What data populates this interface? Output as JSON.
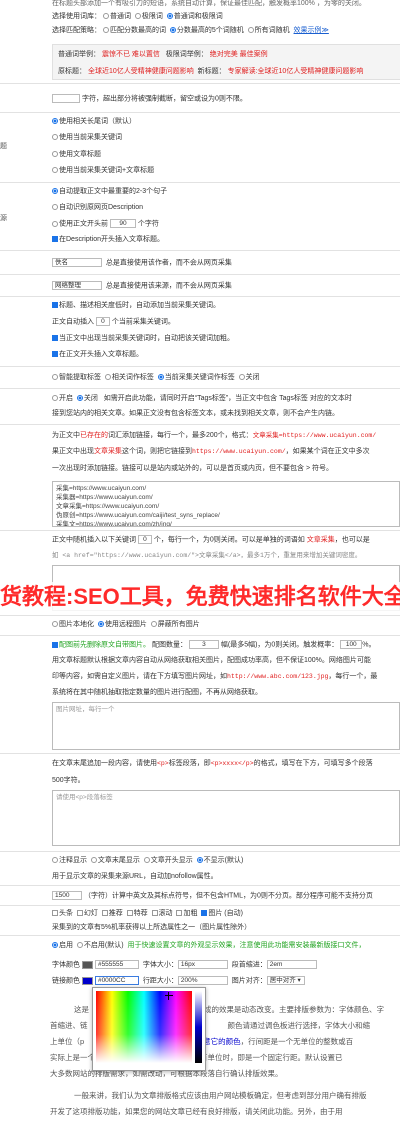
{
  "top": {
    "line1": "在标题头部添加一个有吸引力的短语，系统自动计算，保证最佳匹配，触发概率100% ，为零的关闭。",
    "match_lib_label": "选择使用词库：",
    "match_lib_opts": [
      "普通词",
      "极限词",
      "普通词和极限词"
    ],
    "match_mode_label": "选择匹配策略：",
    "match_mode_opts": [
      "匹配分数最高的词",
      "分数最高的5个词随机",
      "所有词随机"
    ],
    "effect_link": "效果示例≫",
    "example1_label": "普通词举例：",
    "example1_a": "震惊不已  难以置信",
    "example1_mid": "极限词举例：",
    "example1_b": "绝对完美  最佳案例",
    "example2_label": "原标题：",
    "example2_a": "全球近10亿人受精神健康问题影响",
    "example2_mid": "新标题：",
    "example2_b": "专家解读:全球近10亿人受精神健康问题影响"
  },
  "truncate": {
    "text": "字符，超出部分将被强制截断，留空或设为0则不限。"
  },
  "keyword_src": {
    "label": "题",
    "opts": [
      "使用相关长尾词（默认）",
      "使用当前采集关键词",
      "使用文章标题",
      "使用当前采集关键词+文章标题"
    ]
  },
  "desc_src": {
    "label": "源",
    "opts": [
      "自动提取正文中最重要的2-3个句子",
      "自动识别原网页Description",
      "使用正文开头前"
    ],
    "chars_value": "90",
    "chars_suffix": "个字符",
    "check_label": "在Description开头插入文章标题。"
  },
  "author": {
    "value": "佚名",
    "text": "总是直接使用该作者，而不会从网页采集"
  },
  "source": {
    "value": "网络整理",
    "text": "总是直接使用该来源，而不会从网页采集"
  },
  "kw_insert": {
    "l1": "标题、描述相关度低时，自动添加当前采集关键词。",
    "l2a": "正文自动插入",
    "l2_value": "0",
    "l2b": "个当前采集关键词。",
    "l3": "当正文中出现当前采集关键词时，自动把该关键词加粗。",
    "l4": "在正文开头插入文章标题。"
  },
  "tag_mode": {
    "opts": [
      "智能提取标签",
      "相关词作标签",
      "当前采集关键词作标签",
      "关闭"
    ]
  },
  "tag_link": {
    "opts": [
      "开启",
      "关闭"
    ],
    "l1": "如需开启此功能，请同时开启“Tags标签”，当正文中包含 Tags标签 对应的文本时",
    "l2": "接到您站内的相关文章。如果正文没有包含标签文本，或未找到相关文章，则不会产生内链。"
  },
  "link_words": {
    "l1a": "为正文中",
    "l1b": "已存在的",
    "l1c": "词汇添加链接，每行一个，最多200个，格式：",
    "l1d": "文章采集=https://www.ucaiyun.com/",
    "l2a": "果正文中出现",
    "l2b": "文章采集",
    "l2c": "这个词，则把它链接到",
    "l2d": "https://www.ucaiyun.com/",
    "l2e": "，如果某个词在正文中多次",
    "l3": "一次出现时添加链接。链接可以是站内或站外的，可以是首页或内页，但不要包含 > 符号。",
    "textarea": "采集=https://www.ucaiyun.com/\n采集器=https://www.ucaiyun.com/\n文章采集=https://www.ucaiyun.com/\n伪原创=https://www.ucaiyun.com/caiji/test_syns_replace/\n采集文=https://www.ucaiyun.com/zh/ing/"
  },
  "random_link": {
    "l1a": "正文中随机插入以下关键词",
    "l1_value": "0",
    "l1b": "个，每行一个，为0则关闭。可以是单独的词语如",
    "l1c": "文章采集",
    "l1d": "，也可以是",
    "l2": "如 <a href=\"https://www.ucaiyun.com/\">文章采集</a>，最多1万个，重复用来增加关键词密度。"
  },
  "banner": {
    "text": "货教程:SEO工具，免费快速排名软件大全"
  },
  "img_mode": {
    "opts": [
      "图片本地化",
      "使用远程图片",
      "屏蔽所有图片"
    ]
  },
  "img_match": {
    "l1a": "配图前先删除原文自带图片。",
    "l1b": "配图数量：",
    "l1_value": "3",
    "l1c": "幅(最多5幅)，为0则关闭。触发概率：",
    "l1_prob": "100",
    "l1d": "%。",
    "l2": "用文章标题默认根据文章内容自动从网络获取相关图片，配图成功率高，但不保证100%。网络图片可能",
    "l3a": "印等内容，如需自定义图片，请在下方填写图片网址，如",
    "l3b": "http://www.abc.com/123.jpg",
    "l3c": "，每行一个，最",
    "l4": "系统将在其中随机抽取指定数量的图片进行配图，不再从网络获取。",
    "placeholder": "图片网址，每行一个"
  },
  "tail_para": {
    "l1a": "在文章末尾追加一段内容，请使用",
    "l1b": "<p>",
    "l1c": "标签段落，即",
    "l1d": "<p>xxxx</p>",
    "l1e": "的格式，填写在下方，可填写多个段落",
    "l2": "500字符。",
    "placeholder": "请使用<p>段落标签"
  },
  "source_show": {
    "opts": [
      "注释显示",
      "文章末尾显示",
      "文章开头显示",
      "不显示(默认)"
    ],
    "l2": "用于显示文章的采集来源URL，自动加nofollow属性。"
  },
  "word_count": {
    "value": "1500",
    "text": "（字符）计算中英文及其标点符号，但不包含HTML，为0则不分页。部分程序可能不支持分页"
  },
  "flags": {
    "opts": [
      "头条",
      "幻灯",
      "推荐",
      "特荐",
      "滚动",
      "加粗",
      "图片 (自动)"
    ],
    "l2": "采集到的文章有5%机率获得以上所选属性之一（图片属性除外）"
  },
  "style": {
    "opts": [
      "启用",
      "不启用(默认)"
    ],
    "l1a": "用于快速设置文章的外观显示效果，注意使用此功能需安装最新版接口文件，",
    "font_color_label": "字体颜色",
    "font_color_value": "#555555",
    "font_size_label": "字体大小：",
    "font_size_value": "16px",
    "indent_label": "段首缩进：",
    "indent_value": "2em",
    "link_color_label": "链接颜色",
    "link_color_value": "#0000CC",
    "line_height_label": "行距大小：",
    "line_height_value": "200%",
    "align_label": "图片对齐：",
    "align_value": "居中对齐",
    "p1a": "这是",
    "p1b": "后生成的效果是动态改变。主要排版参数为：字体颜色、字",
    "p2a": "首缩进、链",
    "p2b": "颜色请通过调色板进行选择，字体大小和缩",
    "p3a": "上单位（p",
    "p3b": "意它的颜色",
    "p3c": "，行间距是一个无单位的整数或百",
    "p4": "实际上是一个以字体大小为基数的行距倍数；有单位时，即是一个固定行距。默认设置已",
    "p5": "大多数网站的排版需求，如需改动，可根据本段落自行确认排版效果。",
    "p6": "一般来讲，我们认为文章排版格式应该由用户网站模板确定，但考虑到部分用户确有排版",
    "p7": "开发了这项排版功能，如果您的网站文章已经有良好排版，请关闭此功能。另外，由于用"
  },
  "colors": {
    "accent": "#1a73e8",
    "red": "#e02020",
    "green": "#21a321",
    "banner": "#ff2a2a",
    "font_color": "#555555",
    "link_color": "#0000CC"
  }
}
